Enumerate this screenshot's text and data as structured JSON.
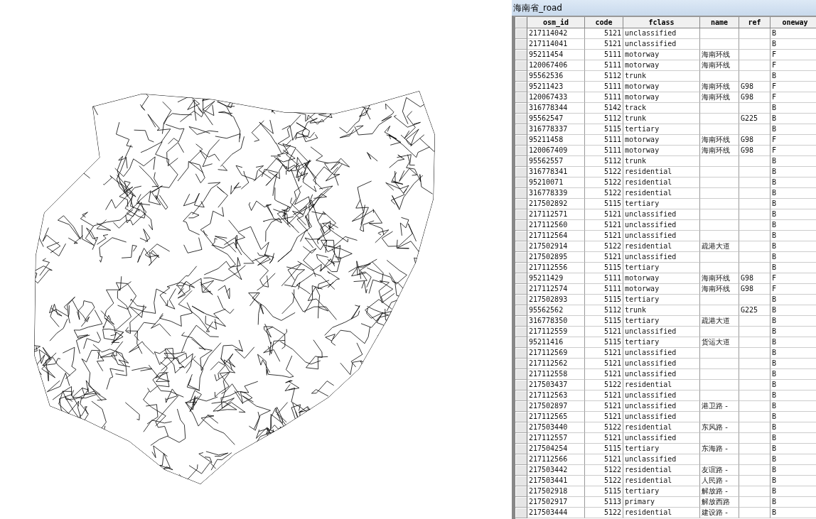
{
  "table_window": {
    "title": "海南省_road"
  },
  "columns": [
    "osm_id",
    "code",
    "fclass",
    "name",
    "ref",
    "oneway"
  ],
  "rows": [
    {
      "osm_id": "217114042",
      "code": "5121",
      "fclass": "unclassified",
      "oneway": "B"
    },
    {
      "osm_id": "217114041",
      "code": "5121",
      "fclass": "unclassified",
      "oneway": "B"
    },
    {
      "osm_id": "95211454",
      "code": "5111",
      "fclass": "motorway",
      "name": "海南环线",
      "oneway": "F"
    },
    {
      "osm_id": "120067406",
      "code": "5111",
      "fclass": "motorway",
      "name": "海南环线",
      "oneway": "F"
    },
    {
      "osm_id": "95562536",
      "code": "5112",
      "fclass": "trunk",
      "oneway": "B"
    },
    {
      "osm_id": "95211423",
      "code": "5111",
      "fclass": "motorway",
      "name": "海南环线",
      "ref": "G98",
      "oneway": "F"
    },
    {
      "osm_id": "120067433",
      "code": "5111",
      "fclass": "motorway",
      "name": "海南环线",
      "ref": "G98",
      "oneway": "F"
    },
    {
      "osm_id": "316778344",
      "code": "5142",
      "fclass": "track",
      "oneway": "B"
    },
    {
      "osm_id": "95562547",
      "code": "5112",
      "fclass": "trunk",
      "ref": "G225",
      "oneway": "B"
    },
    {
      "osm_id": "316778337",
      "code": "5115",
      "fclass": "tertiary",
      "oneway": "B"
    },
    {
      "osm_id": "95211458",
      "code": "5111",
      "fclass": "motorway",
      "name": "海南环线",
      "ref": "G98",
      "oneway": "F"
    },
    {
      "osm_id": "120067409",
      "code": "5111",
      "fclass": "motorway",
      "name": "海南环线",
      "ref": "G98",
      "oneway": "F"
    },
    {
      "osm_id": "95562557",
      "code": "5112",
      "fclass": "trunk",
      "oneway": "B"
    },
    {
      "osm_id": "316778341",
      "code": "5122",
      "fclass": "residential",
      "oneway": "B"
    },
    {
      "osm_id": "95210071",
      "code": "5122",
      "fclass": "residential",
      "oneway": "B"
    },
    {
      "osm_id": "316778339",
      "code": "5122",
      "fclass": "residential",
      "oneway": "B"
    },
    {
      "osm_id": "217502892",
      "code": "5115",
      "fclass": "tertiary",
      "oneway": "B"
    },
    {
      "osm_id": "217112571",
      "code": "5121",
      "fclass": "unclassified",
      "oneway": "B"
    },
    {
      "osm_id": "217112560",
      "code": "5121",
      "fclass": "unclassified",
      "oneway": "B"
    },
    {
      "osm_id": "217112564",
      "code": "5121",
      "fclass": "unclassified",
      "oneway": "B"
    },
    {
      "osm_id": "217502914",
      "code": "5122",
      "fclass": "residential",
      "name": "疏港大道",
      "oneway": "B"
    },
    {
      "osm_id": "217502895",
      "code": "5121",
      "fclass": "unclassified",
      "oneway": "B"
    },
    {
      "osm_id": "217112556",
      "code": "5115",
      "fclass": "tertiary",
      "oneway": "B"
    },
    {
      "osm_id": "95211429",
      "code": "5111",
      "fclass": "motorway",
      "name": "海南环线",
      "ref": "G98",
      "oneway": "F"
    },
    {
      "osm_id": "217112574",
      "code": "5111",
      "fclass": "motorway",
      "name": "海南环线",
      "ref": "G98",
      "oneway": "F"
    },
    {
      "osm_id": "217502893",
      "code": "5115",
      "fclass": "tertiary",
      "oneway": "B"
    },
    {
      "osm_id": "95562562",
      "code": "5112",
      "fclass": "trunk",
      "ref": "G225",
      "oneway": "B"
    },
    {
      "osm_id": "316778350",
      "code": "5115",
      "fclass": "tertiary",
      "name": "疏港大道",
      "oneway": "B"
    },
    {
      "osm_id": "217112559",
      "code": "5121",
      "fclass": "unclassified",
      "oneway": "B"
    },
    {
      "osm_id": "95211416",
      "code": "5115",
      "fclass": "tertiary",
      "name": "货运大道",
      "oneway": "B"
    },
    {
      "osm_id": "217112569",
      "code": "5121",
      "fclass": "unclassified",
      "oneway": "B"
    },
    {
      "osm_id": "217112562",
      "code": "5121",
      "fclass": "unclassified",
      "oneway": "B"
    },
    {
      "osm_id": "217112558",
      "code": "5121",
      "fclass": "unclassified",
      "oneway": "B"
    },
    {
      "osm_id": "217503437",
      "code": "5122",
      "fclass": "residential",
      "oneway": "B"
    },
    {
      "osm_id": "217112563",
      "code": "5121",
      "fclass": "unclassified",
      "oneway": "B"
    },
    {
      "osm_id": "217502897",
      "code": "5121",
      "fclass": "unclassified",
      "name": "港卫路 -",
      "oneway": "B"
    },
    {
      "osm_id": "217112565",
      "code": "5121",
      "fclass": "unclassified",
      "oneway": "B"
    },
    {
      "osm_id": "217503440",
      "code": "5122",
      "fclass": "residential",
      "name": "东风路 -",
      "oneway": "B"
    },
    {
      "osm_id": "217112557",
      "code": "5121",
      "fclass": "unclassified",
      "oneway": "B"
    },
    {
      "osm_id": "217504254",
      "code": "5115",
      "fclass": "tertiary",
      "name": "东海路 -",
      "oneway": "B"
    },
    {
      "osm_id": "217112566",
      "code": "5121",
      "fclass": "unclassified",
      "oneway": "B"
    },
    {
      "osm_id": "217503442",
      "code": "5122",
      "fclass": "residential",
      "name": "友谊路 -",
      "oneway": "B"
    },
    {
      "osm_id": "217503441",
      "code": "5122",
      "fclass": "residential",
      "name": "人民路 -",
      "oneway": "B"
    },
    {
      "osm_id": "217502918",
      "code": "5115",
      "fclass": "tertiary",
      "name": "解放路 -",
      "oneway": "B"
    },
    {
      "osm_id": "217502917",
      "code": "5113",
      "fclass": "primary",
      "name": "解放西路",
      "oneway": "B"
    },
    {
      "osm_id": "217503444",
      "code": "5122",
      "fclass": "residential",
      "name": "建设路 -",
      "oneway": "B"
    }
  ]
}
